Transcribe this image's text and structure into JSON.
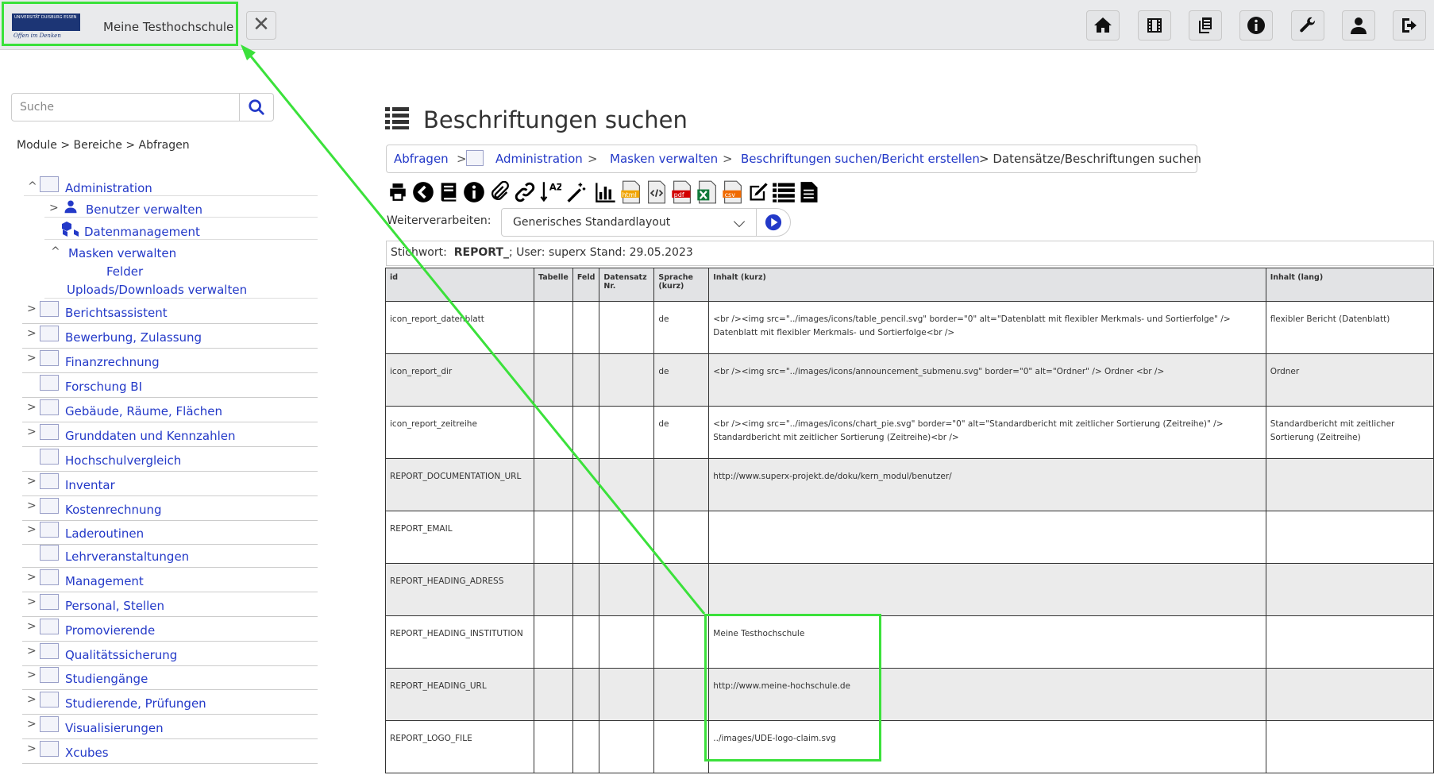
{
  "header": {
    "logo_text": "UNIVERSITÄT DUISBURG ESSEN",
    "logo_claim": "Offen im Denken",
    "title": "Meine Testhochschule",
    "close_label": "✕"
  },
  "top_icons": [
    "home-icon",
    "film-icon",
    "copy-icon",
    "info-icon",
    "wrench-icon",
    "user-icon",
    "logout-icon"
  ],
  "sidebar": {
    "search_placeholder": "Suche",
    "breadcrumb": "Module > Bereiche > Abfragen",
    "admin": {
      "toggle": "^",
      "label": "Administration",
      "children": [
        {
          "toggle": ">",
          "label": "Benutzer verwalten"
        },
        {
          "toggle": "",
          "label": "Datenmanagement"
        },
        {
          "toggle": "^",
          "label": "Masken verwalten"
        },
        {
          "toggle": "",
          "label": "Felder"
        },
        {
          "toggle": "",
          "label": "Uploads/Downloads verwalten"
        }
      ]
    },
    "items": [
      {
        "toggle": ">",
        "label": "Berichtsassistent"
      },
      {
        "toggle": ">",
        "label": "Bewerbung, Zulassung"
      },
      {
        "toggle": ">",
        "label": "Finanzrechnung"
      },
      {
        "toggle": "",
        "label": "Forschung BI"
      },
      {
        "toggle": ">",
        "label": "Gebäude, Räume, Flächen"
      },
      {
        "toggle": ">",
        "label": "Grunddaten und Kennzahlen"
      },
      {
        "toggle": "",
        "label": "Hochschulvergleich"
      },
      {
        "toggle": ">",
        "label": "Inventar"
      },
      {
        "toggle": ">",
        "label": "Kostenrechnung"
      },
      {
        "toggle": ">",
        "label": "Laderoutinen"
      },
      {
        "toggle": "",
        "label": "Lehrveranstaltungen"
      },
      {
        "toggle": ">",
        "label": "Management"
      },
      {
        "toggle": ">",
        "label": "Personal, Stellen"
      },
      {
        "toggle": ">",
        "label": "Promovierende"
      },
      {
        "toggle": ">",
        "label": "Qualitätssicherung"
      },
      {
        "toggle": ">",
        "label": "Studiengänge"
      },
      {
        "toggle": ">",
        "label": "Studierende, Prüfungen"
      },
      {
        "toggle": ">",
        "label": "Visualisierungen"
      },
      {
        "toggle": ">",
        "label": "Xcubes"
      }
    ]
  },
  "main": {
    "title": "Beschriftungen suchen",
    "breadcrumb": {
      "abfragen": "Abfragen",
      "sep1": ">",
      "administration": "Administration",
      "sep2": ">",
      "masken": "Masken verwalten",
      "sep3": ">",
      "bericht": "Beschriftungen suchen/Bericht erstellen",
      "current": "> Datensätze/Beschriftungen suchen"
    },
    "weiterverarbeiten_label": "Weiterverarbeiten:",
    "layout_selected": "Generisches Standardlayout",
    "stichwort": {
      "label": "Stichwort:",
      "keyword": "REPORT_",
      "rest": "; User: superx Stand: 29.05.2023"
    },
    "table": {
      "columns": [
        "id",
        "Tabelle",
        "Feld",
        "Datensatz Nr.",
        "Sprache (kurz)",
        "Inhalt (kurz)",
        "Inhalt (lang)"
      ],
      "rows": [
        [
          "icon_report_datenblatt",
          "",
          "",
          "",
          "de",
          "<br /><img src=\"../images/icons/table_pencil.svg\" border=\"0\" alt=\"Datenblatt mit flexibler Merkmals- und Sortierfolge\" /> Datenblatt mit flexibler Merkmals- und Sortierfolge<br />",
          "flexibler Bericht (Datenblatt)"
        ],
        [
          "icon_report_dir",
          "",
          "",
          "",
          "de",
          "<br /><img src=\"../images/icons/announcement_submenu.svg\" border=\"0\" alt=\"Ordner\" /> Ordner <br />",
          "Ordner"
        ],
        [
          "icon_report_zeitreihe",
          "",
          "",
          "",
          "de",
          "<br /><img src=\"../images/icons/chart_pie.svg\" border=\"0\" alt=\"Standardbericht mit zeitlicher Sortierung (Zeitreihe)\" /> Standardbericht mit zeitlicher Sortierung (Zeitreihe)<br />",
          "Standardbericht mit zeitlicher Sortierung (Zeitreihe)"
        ],
        [
          "REPORT_DOCUMENTATION_URL",
          "",
          "",
          "",
          "",
          "http://www.superx-projekt.de/doku/kern_modul/benutzer/",
          ""
        ],
        [
          "REPORT_EMAIL",
          "",
          "",
          "",
          "",
          "",
          ""
        ],
        [
          "REPORT_HEADING_ADRESS",
          "",
          "",
          "",
          "",
          "",
          ""
        ],
        [
          "REPORT_HEADING_INSTITUTION",
          "",
          "",
          "",
          "",
          "Meine Testhochschule",
          ""
        ],
        [
          "REPORT_HEADING_URL",
          "",
          "",
          "",
          "",
          "http://www.meine-hochschule.de",
          ""
        ],
        [
          "REPORT_LOGO_FILE",
          "",
          "",
          "",
          "",
          "../images/UDE-logo-claim.svg",
          ""
        ]
      ]
    }
  },
  "toolbar_icons": [
    "print-icon",
    "back-icon",
    "book-icon",
    "info-icon",
    "paperclip-icon",
    "link-icon",
    "sort-az-icon",
    "magic-wand-icon",
    "bar-chart-icon",
    "html-export-icon",
    "xml-export-icon",
    "pdf-export-icon",
    "excel-export-icon",
    "csv-export-icon",
    "edit-icon",
    "list-icon",
    "document-icon"
  ],
  "toolbar_labels": {
    "html": "html",
    "pdf": "pdf",
    "csv": "csv",
    "az": "AZ"
  },
  "colors": {
    "link": "#2339c8",
    "highlight": "#3be13b",
    "topbar": "#e9eaec"
  }
}
